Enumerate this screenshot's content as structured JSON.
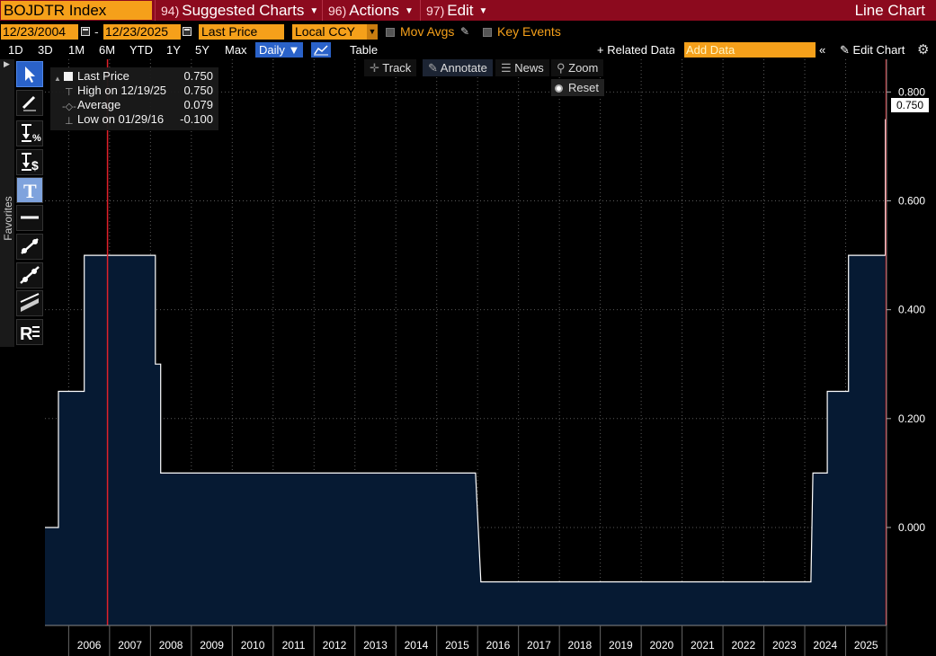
{
  "header": {
    "ticker": "BOJDTR Index",
    "menus": [
      {
        "num": "94)",
        "label": "Suggested Charts"
      },
      {
        "num": "96)",
        "label": "Actions"
      },
      {
        "num": "97)",
        "label": "Edit"
      }
    ],
    "chart_type": "Line Chart"
  },
  "range": {
    "start": "12/23/2004",
    "dash": "-",
    "end": "12/23/2025",
    "field": "Last Price",
    "currency": "Local CCY",
    "mov_avgs": "Mov Avgs",
    "key_events": "Key Events"
  },
  "toolbar": {
    "periods": [
      "1D",
      "3D",
      "1M",
      "6M",
      "YTD",
      "1Y",
      "5Y",
      "Max"
    ],
    "frequency": "Daily ▼",
    "table": "Table",
    "related": "+ Related Data",
    "add_data_placeholder": "Add Data",
    "collapse": "«",
    "edit_chart": "✎ Edit Chart",
    "settings": "⚙"
  },
  "palette": {
    "favorites": "Favorites",
    "tools": [
      "cursor-icon",
      "pencil-icon",
      "percent-measure-icon",
      "dollar-measure-icon",
      "text-tool-icon",
      "horizontal-line-icon",
      "trend-line-icon",
      "channel-line-icon",
      "fib-tool-icon",
      "regression-icon"
    ]
  },
  "legend": {
    "last_price_label": "Last Price",
    "last_price_value": "0.750",
    "high_label": "High on 12/19/25",
    "high_value": "0.750",
    "average_label": "Average",
    "average_value": "0.079",
    "low_label": "Low on 01/29/16",
    "low_value": "-0.100"
  },
  "chart_tools": {
    "track": "Track",
    "annotate": "Annotate",
    "news": "News",
    "zoom": "Zoom",
    "reset": "Reset"
  },
  "last_value_tag": "0.750",
  "colors": {
    "title_bar": "#8c0a1e",
    "accent_orange": "#f5a01a",
    "fill": "#061a33",
    "line": "#ffffff",
    "event_line": "#e0202a",
    "grid": "#5a5a5a"
  },
  "chart_data": {
    "type": "area",
    "xlim": [
      2005.42,
      2026.0
    ],
    "ylim": [
      -0.18,
      0.86
    ],
    "y_ticks": [
      0.0,
      0.2,
      0.4,
      0.6,
      0.8
    ],
    "y_tick_labels": [
      "0.000",
      "0.200",
      "0.400",
      "0.600",
      "0.800"
    ],
    "x_ticks": [
      2006,
      2007,
      2008,
      2009,
      2010,
      2011,
      2012,
      2013,
      2014,
      2015,
      2016,
      2017,
      2018,
      2019,
      2020,
      2021,
      2022,
      2023,
      2024,
      2025
    ],
    "x_tick_labels": [
      "2006",
      "2007",
      "2008",
      "2009",
      "2010",
      "2011",
      "2012",
      "2013",
      "2014",
      "2015",
      "2016",
      "2017",
      "2018",
      "2019",
      "2020",
      "2021",
      "2022",
      "2023",
      "2024",
      "2025"
    ],
    "grid": true,
    "step_points": [
      [
        2005.42,
        0.0
      ],
      [
        2005.75,
        0.0
      ],
      [
        2005.75,
        0.25
      ],
      [
        2006.38,
        0.25
      ],
      [
        2006.38,
        0.5
      ],
      [
        2008.12,
        0.5
      ],
      [
        2008.12,
        0.3
      ],
      [
        2008.25,
        0.3
      ],
      [
        2008.25,
        0.1
      ],
      [
        2015.95,
        0.1
      ],
      [
        2016.08,
        -0.1
      ],
      [
        2024.15,
        -0.1
      ],
      [
        2024.2,
        0.1
      ],
      [
        2024.55,
        0.1
      ],
      [
        2024.55,
        0.25
      ],
      [
        2025.07,
        0.25
      ],
      [
        2025.07,
        0.5
      ],
      [
        2025.97,
        0.5
      ],
      [
        2025.97,
        0.75
      ]
    ],
    "event_lines_x": [
      2006.95,
      2025.99
    ]
  }
}
